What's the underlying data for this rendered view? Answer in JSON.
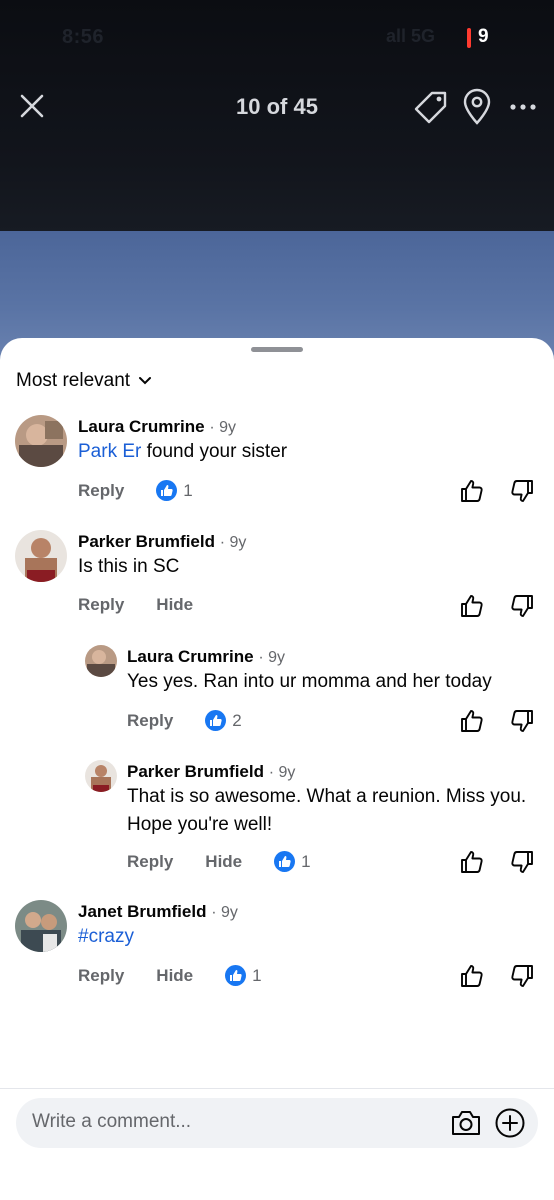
{
  "status_bar": {
    "time": "8:56",
    "signal": "all 5G",
    "battery": "9"
  },
  "viewer": {
    "counter": "10 of 45",
    "icons": [
      "close-icon",
      "tag-icon",
      "location-pin-icon",
      "more-icon"
    ]
  },
  "comments_sheet": {
    "sort_label": "Most relevant",
    "comments": [
      {
        "author": "Laura Crumrine",
        "time": "· 9y",
        "mention": "Park Er",
        "text": " found your sister",
        "reply_label": "Reply",
        "like_count": "1"
      },
      {
        "author": "Parker Brumfield",
        "time": "· 9y",
        "text": "Is this in SC",
        "reply_label": "Reply",
        "hide_label": "Hide"
      },
      {
        "author": "Laura Crumrine",
        "time": "· 9y",
        "text": "Yes yes. Ran into ur momma and her today",
        "reply_label": "Reply",
        "like_count": "2"
      },
      {
        "author": "Parker Brumfield",
        "time": "· 9y",
        "text_line1": "That is so awesome. What a reunion. Miss you.",
        "text_line2": "Hope you're well!",
        "reply_label": "Reply",
        "hide_label": "Hide",
        "like_count": "1"
      },
      {
        "author": "Janet Brumfield",
        "time": "· 9y",
        "hashtag": "#crazy",
        "reply_label": "Reply",
        "hide_label": "Hide",
        "like_count": "1"
      }
    ]
  },
  "composer": {
    "placeholder": "Write a comment...",
    "icons": [
      "camera-icon",
      "add-icon"
    ]
  },
  "colors": {
    "accent": "#1877f2",
    "mention": "#1b5fd6",
    "secondary_text": "#65676b"
  }
}
